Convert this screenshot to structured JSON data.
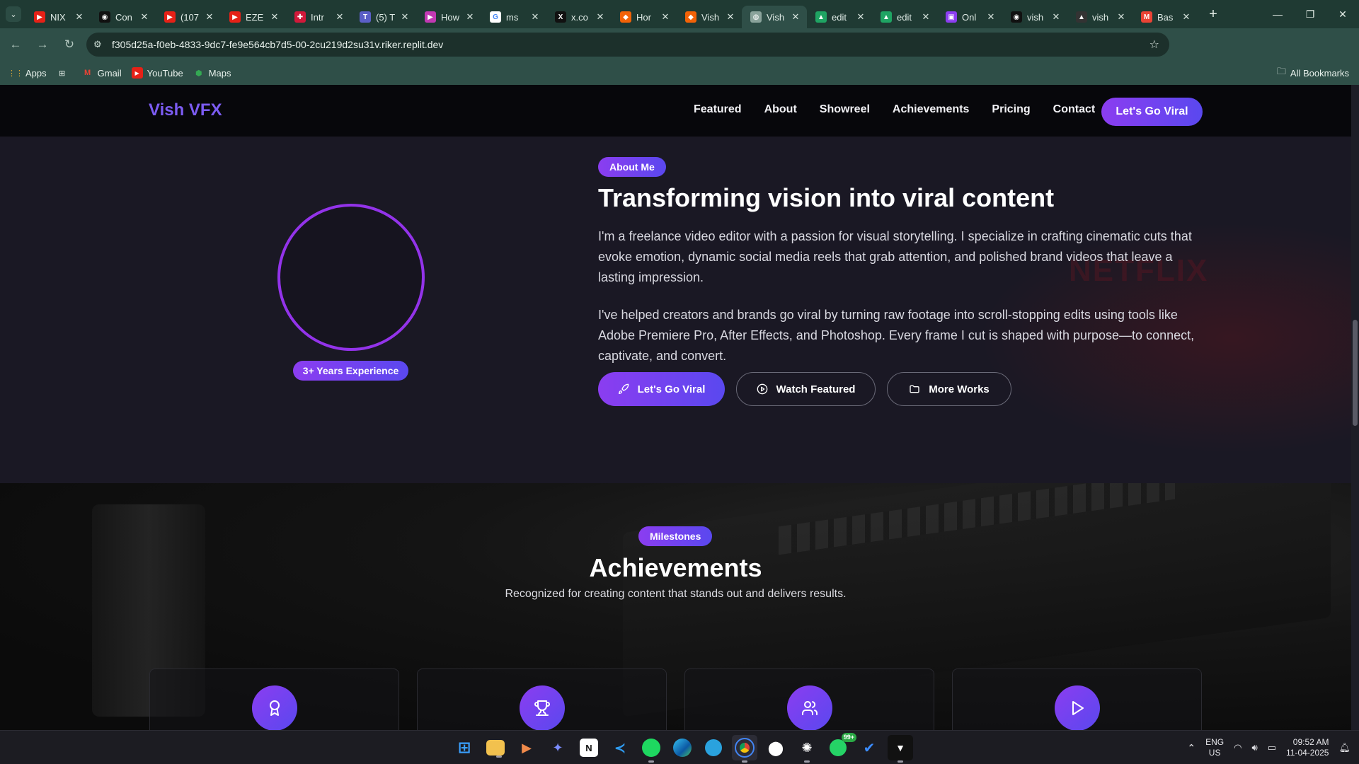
{
  "browser": {
    "tabs": [
      {
        "title": "NIX",
        "favicon": "youtube-icon",
        "color": "#e62117"
      },
      {
        "title": "Con",
        "favicon": "github-icon",
        "color": "#111111"
      },
      {
        "title": "(107",
        "favicon": "youtube-icon",
        "color": "#e62117"
      },
      {
        "title": "EZE",
        "favicon": "youtube-icon",
        "color": "#e62117"
      },
      {
        "title": "Intr",
        "favicon": "red-logo-icon",
        "color": "#d1193a"
      },
      {
        "title": "(5) T",
        "favicon": "teams-icon",
        "color": "#5b5fc7"
      },
      {
        "title": "How",
        "favicon": "clipchamp-icon",
        "color": "#c239b3"
      },
      {
        "title": "ms",
        "favicon": "google-icon",
        "color": "#ffffff"
      },
      {
        "title": "x.co",
        "favicon": "x-icon",
        "color": "#111111"
      },
      {
        "title": "Hor",
        "favicon": "replit-icon",
        "color": "#f26207"
      },
      {
        "title": "Vish",
        "favicon": "replit-icon",
        "color": "#f26207"
      },
      {
        "title": "Vish",
        "favicon": "globe-icon",
        "color": "#8aa39b"
      },
      {
        "title": "edit",
        "favicon": "drive-icon",
        "color": "#1fa463"
      },
      {
        "title": "edit",
        "favicon": "drive-icon",
        "color": "#1fa463"
      },
      {
        "title": "Onl",
        "favicon": "onlinegdb-icon",
        "color": "#8b3df0"
      },
      {
        "title": "vish",
        "favicon": "github-icon",
        "color": "#111111"
      },
      {
        "title": "vish",
        "favicon": "vercel-icon",
        "color": "#333333"
      },
      {
        "title": "Bas",
        "favicon": "gmail-icon",
        "color": "#ea4335"
      }
    ],
    "active_tab_index": 11,
    "url": "f305d25a-f0eb-4833-9dc7-fe9e564cb7d5-00-2cu219d2su31v.riker.replit.dev",
    "bookmarks": [
      {
        "label": "Apps",
        "icon": "apps-grid-icon"
      },
      {
        "label": "",
        "icon": "tab-groups-icon"
      },
      {
        "label": "Gmail",
        "icon": "gmail-icon"
      },
      {
        "label": "YouTube",
        "icon": "youtube-icon"
      },
      {
        "label": "Maps",
        "icon": "maps-icon"
      }
    ],
    "all_bookmarks_label": "All Bookmarks"
  },
  "site": {
    "logo": "Vish VFX",
    "nav": [
      "Featured",
      "About",
      "Showreel",
      "Achievements",
      "Pricing",
      "Contact"
    ],
    "nav_cta": "Let's Go Viral",
    "about": {
      "pill": "About Me",
      "title": "Transforming vision into viral content",
      "p1": "I'm a freelance video editor with a passion for visual storytelling. I specialize in crafting cinematic cuts that evoke emotion, dynamic social media reels that grab attention, and polished brand videos that leave a lasting impression.",
      "p2": "I've helped creators and brands go viral by turning raw footage into scroll-stopping edits using tools like Adobe Premiere Pro, After Effects, and Photoshop. Every frame I cut is shaped with purpose—to connect, captivate, and convert.",
      "experience_badge": "3+ Years Experience",
      "background_watermark": "NETFLIX",
      "buttons": [
        {
          "label": "Let's Go Viral",
          "icon": "rocket-icon"
        },
        {
          "label": "Watch Featured",
          "icon": "play-circle-icon"
        },
        {
          "label": "More Works",
          "icon": "folder-icon"
        }
      ]
    },
    "achievements": {
      "pill": "Milestones",
      "title": "Achievements",
      "subtitle": "Recognized for creating content that stands out and delivers results.",
      "cards": [
        {
          "icon": "award-icon"
        },
        {
          "icon": "trophy-icon"
        },
        {
          "icon": "users-icon"
        },
        {
          "icon": "play-icon"
        }
      ]
    }
  },
  "taskbar": {
    "apps": [
      "windows-start-icon",
      "file-explorer-icon",
      "media-player-icon",
      "copilot-icon",
      "notion-icon",
      "vscode-icon",
      "spotify-icon",
      "edge-icon",
      "telegram-icon",
      "chrome-icon",
      "github-desktop-icon",
      "chatgpt-icon",
      "whatsapp-icon",
      "todo-icon",
      "terminal-icon"
    ],
    "whatsapp_badge": "99+",
    "lang_line1": "ENG",
    "lang_line2": "US",
    "time": "09:52 AM",
    "date": "11-04-2025"
  },
  "colors": {
    "accent_purple": "#8b3df0",
    "accent_indigo": "#5a48ef",
    "page_bg": "#1a1824",
    "nav_bg": "#07070b"
  }
}
